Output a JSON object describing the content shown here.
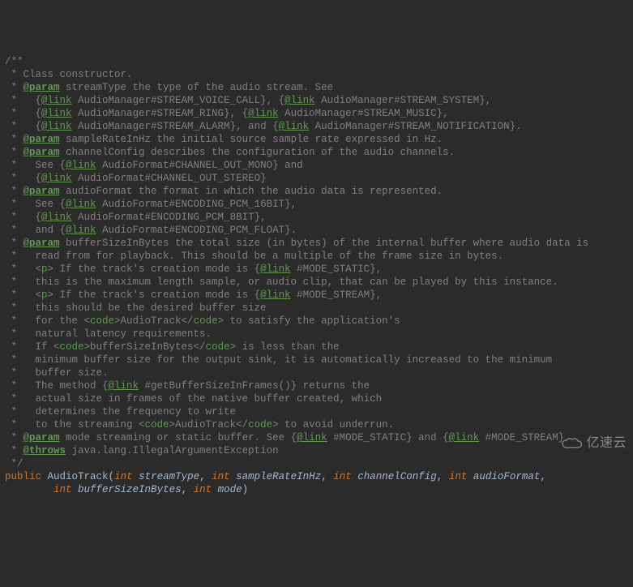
{
  "lines": [
    {
      "t": "c",
      "v": "/**"
    },
    {
      "t": "c",
      "v": " * Class constructor."
    },
    {
      "t": "p",
      "pre": " * ",
      "tag": "@param",
      "post": " streamType the type of the audio stream. See"
    },
    {
      "t": "l",
      "pre": " *   {",
      "tag": "@link",
      "mid": " AudioManager#STREAM_VOICE_CALL}, {",
      "tag2": "@link",
      "end": " AudioManager#STREAM_SYSTEM},"
    },
    {
      "t": "l",
      "pre": " *   {",
      "tag": "@link",
      "mid": " AudioManager#STREAM_RING}, {",
      "tag2": "@link",
      "end": " AudioManager#STREAM_MUSIC},"
    },
    {
      "t": "l",
      "pre": " *   {",
      "tag": "@link",
      "mid": " AudioManager#STREAM_ALARM}, and {",
      "tag2": "@link",
      "end": " AudioManager#STREAM_NOTIFICATION}."
    },
    {
      "t": "p",
      "pre": " * ",
      "tag": "@param",
      "post": " sampleRateInHz the initial source sample rate expressed in Hz."
    },
    {
      "t": "p",
      "pre": " * ",
      "tag": "@param",
      "post": " channelConfig describes the configuration of the audio channels."
    },
    {
      "t": "l1",
      "pre": " *   See {",
      "tag": "@link",
      "end": " AudioFormat#CHANNEL_OUT_MONO} and"
    },
    {
      "t": "l1",
      "pre": " *   {",
      "tag": "@link",
      "end": " AudioFormat#CHANNEL_OUT_STEREO}"
    },
    {
      "t": "p",
      "pre": " * ",
      "tag": "@param",
      "post": " audioFormat the format in which the audio data is represented."
    },
    {
      "t": "l1",
      "pre": " *   See {",
      "tag": "@link",
      "end": " AudioFormat#ENCODING_PCM_16BIT},"
    },
    {
      "t": "l1",
      "pre": " *   {",
      "tag": "@link",
      "end": " AudioFormat#ENCODING_PCM_8BIT},"
    },
    {
      "t": "l1",
      "pre": " *   and {",
      "tag": "@link",
      "end": " AudioFormat#ENCODING_PCM_FLOAT}."
    },
    {
      "t": "p",
      "pre": " * ",
      "tag": "@param",
      "post": " bufferSizeInBytes the total size (in bytes) of the internal buffer where audio data is"
    },
    {
      "t": "c",
      "v": " *   read from for playback. This should be a multiple of the frame size in bytes."
    },
    {
      "t": "x",
      "parts": [
        {
          "c": "comment",
          "v": " *   <"
        },
        {
          "c": "code-tag",
          "v": "p"
        },
        {
          "c": "comment",
          "v": "> If the track's creation mode is {"
        },
        {
          "c": "link-tag",
          "v": "@link"
        },
        {
          "c": "comment",
          "v": " #MODE_STATIC},"
        }
      ]
    },
    {
      "t": "c",
      "v": " *   this is the maximum length sample, or audio clip, that can be played by this instance."
    },
    {
      "t": "x",
      "parts": [
        {
          "c": "comment",
          "v": " *   <"
        },
        {
          "c": "code-tag",
          "v": "p"
        },
        {
          "c": "comment",
          "v": "> If the track's creation mode is {"
        },
        {
          "c": "link-tag",
          "v": "@link"
        },
        {
          "c": "comment",
          "v": " #MODE_STREAM},"
        }
      ]
    },
    {
      "t": "c",
      "v": " *   this should be the desired buffer size"
    },
    {
      "t": "x",
      "parts": [
        {
          "c": "comment",
          "v": " *   for the <"
        },
        {
          "c": "code-tag",
          "v": "code"
        },
        {
          "c": "comment",
          "v": ">AudioTrack</"
        },
        {
          "c": "code-tag",
          "v": "code"
        },
        {
          "c": "comment",
          "v": "> to satisfy the application's"
        }
      ]
    },
    {
      "t": "c",
      "v": " *   natural latency requirements."
    },
    {
      "t": "x",
      "parts": [
        {
          "c": "comment",
          "v": " *   If <"
        },
        {
          "c": "code-tag",
          "v": "code"
        },
        {
          "c": "comment",
          "v": ">bufferSizeInBytes</"
        },
        {
          "c": "code-tag",
          "v": "code"
        },
        {
          "c": "comment",
          "v": "> is less than the"
        }
      ]
    },
    {
      "t": "c",
      "v": " *   minimum buffer size for the output sink, it is automatically increased to the minimum"
    },
    {
      "t": "c",
      "v": " *   buffer size."
    },
    {
      "t": "x",
      "parts": [
        {
          "c": "comment",
          "v": " *   The method {"
        },
        {
          "c": "link-tag",
          "v": "@link"
        },
        {
          "c": "comment",
          "v": " #getBufferSizeInFrames()} returns the"
        }
      ]
    },
    {
      "t": "c",
      "v": " *   actual size in frames of the native buffer created, which"
    },
    {
      "t": "c",
      "v": " *   determines the frequency to write"
    },
    {
      "t": "x",
      "parts": [
        {
          "c": "comment",
          "v": " *   to the streaming <"
        },
        {
          "c": "code-tag",
          "v": "code"
        },
        {
          "c": "comment",
          "v": ">AudioTrack</"
        },
        {
          "c": "code-tag",
          "v": "code"
        },
        {
          "c": "comment",
          "v": "> to avoid underrun."
        }
      ]
    },
    {
      "t": "x",
      "parts": [
        {
          "c": "comment",
          "v": " * "
        },
        {
          "c": "param-tag",
          "v": "@param"
        },
        {
          "c": "comment",
          "v": " mode streaming or static buffer. See {"
        },
        {
          "c": "link-tag",
          "v": "@link"
        },
        {
          "c": "comment",
          "v": " #MODE_STATIC} and {"
        },
        {
          "c": "link-tag",
          "v": "@link"
        },
        {
          "c": "comment",
          "v": " #MODE_STREAM}"
        }
      ]
    },
    {
      "t": "p",
      "pre": " * ",
      "tag": "@throws",
      "post": " java.lang.IllegalArgumentException"
    },
    {
      "t": "c",
      "v": " */"
    }
  ],
  "sig1": {
    "kw": "public",
    "cls": "AudioTrack",
    "p1t": "int",
    "p1n": "streamType",
    "p2t": "int",
    "p2n": "sampleRateInHz",
    "p3t": "int",
    "p3n": "channelConfig",
    "p4t": "int",
    "p4n": "audioFormat"
  },
  "sig2": {
    "p5t": "int",
    "p5n": "bufferSizeInBytes",
    "p6t": "int",
    "p6n": "mode"
  },
  "watermark": "亿速云"
}
